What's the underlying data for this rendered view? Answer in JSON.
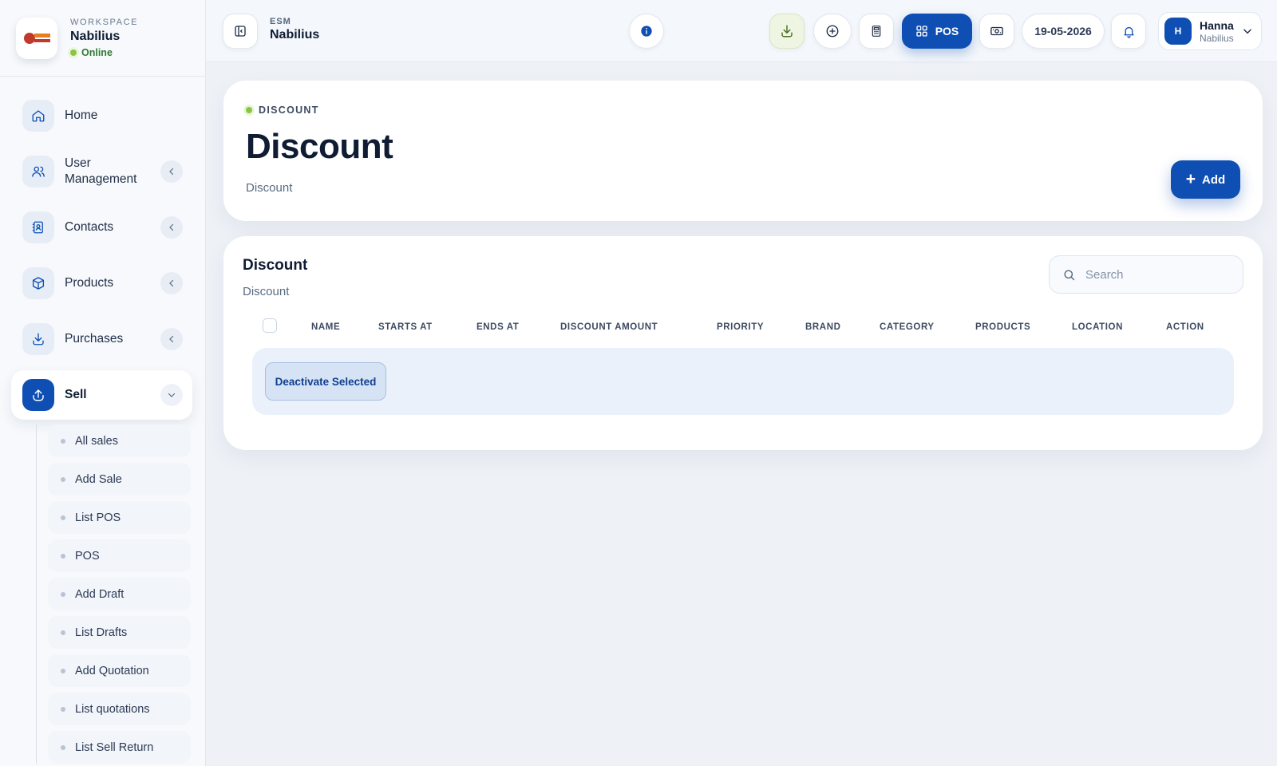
{
  "workspace": {
    "label": "WORKSPACE",
    "name": "Nabilius",
    "status": "Online"
  },
  "sidebar": {
    "items": [
      {
        "label": "Home",
        "icon": "home-icon",
        "has_chevron": false
      },
      {
        "label": "User Management",
        "icon": "users-icon",
        "has_chevron": true
      },
      {
        "label": "Contacts",
        "icon": "contacts-icon",
        "has_chevron": true
      },
      {
        "label": "Products",
        "icon": "box-icon",
        "has_chevron": true
      },
      {
        "label": "Purchases",
        "icon": "download-icon",
        "has_chevron": true
      },
      {
        "label": "Sell",
        "icon": "upload-icon",
        "has_chevron": true,
        "active": true
      }
    ],
    "sell_sub": [
      "All sales",
      "Add Sale",
      "List POS",
      "POS",
      "Add Draft",
      "List Drafts",
      "Add Quotation",
      "List quotations",
      "List Sell Return"
    ]
  },
  "topbar": {
    "esm_label": "ESM",
    "esm_name": "Nabilius",
    "pos_label": "POS",
    "date": "19-05-2026",
    "user_initial": "H",
    "user_name": "Hanna",
    "user_org": "Nabilius"
  },
  "header": {
    "breadcrumb": "DISCOUNT",
    "title": "Discount",
    "subtitle": "Discount",
    "add_label": "Add"
  },
  "table": {
    "title": "Discount",
    "subtitle": "Discount",
    "search_placeholder": "Search",
    "columns": [
      "NAME",
      "STARTS AT",
      "ENDS AT",
      "DISCOUNT AMOUNT",
      "PRIORITY",
      "BRAND",
      "CATEGORY",
      "PRODUCTS",
      "LOCATION",
      "ACTION"
    ],
    "bulk_action_label": "Deactivate Selected"
  },
  "colors": {
    "accent": "#0f4fb4",
    "online": "#8cc63f",
    "background": "#eef1f6"
  }
}
